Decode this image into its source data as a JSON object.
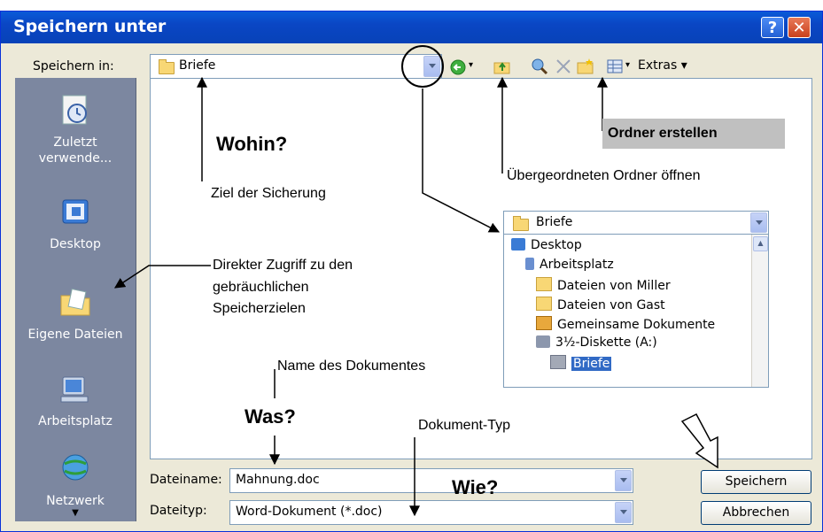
{
  "window": {
    "title": "Speichern unter",
    "help_label": "?",
    "close_label": "✕"
  },
  "toolbar": {
    "save_in_label": "Speichern in:",
    "location": "Briefe",
    "extras_label": "Extras ▾",
    "icons": [
      "back-icon",
      "up-folder-icon",
      "search-web-icon",
      "delete-icon",
      "new-folder-icon",
      "views-icon"
    ]
  },
  "places": [
    {
      "label": "Zuletzt\nverwende...",
      "icon": "recent-icon"
    },
    {
      "label": "Desktop",
      "icon": "desktop-icon"
    },
    {
      "label": "Eigene Dateien",
      "icon": "my-documents-icon"
    },
    {
      "label": "Arbeitsplatz",
      "icon": "my-computer-icon"
    },
    {
      "label": "Netzwerk",
      "icon": "network-icon"
    }
  ],
  "annotations": {
    "wohin": "Wohin?",
    "ziel": "Ziel der Sicherung",
    "ordner_erstellen": "Ordner erstellen",
    "uebergeordnet": "Übergeordneten Ordner öffnen",
    "direkter": "Direkter Zugriff zu den",
    "direkter2": "gebräuchlichen",
    "direkter3": "Speicherzielen",
    "name_des": "Name des Dokumentes",
    "was": "Was?",
    "dokument_typ": "Dokument-Typ",
    "wie": "Wie?"
  },
  "tree": {
    "header": "Briefe",
    "items": [
      {
        "label": "Desktop",
        "indent": 0
      },
      {
        "label": "Arbeitsplatz",
        "indent": 1
      },
      {
        "label": "Dateien von Miller",
        "indent": 2
      },
      {
        "label": "Dateien von Gast",
        "indent": 2
      },
      {
        "label": "Gemeinsame Dokumente",
        "indent": 2
      },
      {
        "label": "3½-Diskette (A:)",
        "indent": 2
      },
      {
        "label": "Briefe",
        "indent": 3,
        "selected": true
      }
    ]
  },
  "form": {
    "filename_label": "Dateiname:",
    "filename_value": "Mahnung.doc",
    "filetype_label": "Dateityp:",
    "filetype_value": "Word-Dokument (*.doc)",
    "save_button": "Speichern",
    "cancel_button": "Abbrechen"
  },
  "colors": {
    "titlebar": "#0a46c4",
    "dialog_bg": "#ece9d8",
    "places_bg": "#7c87a0",
    "folder": "#f8d775"
  }
}
